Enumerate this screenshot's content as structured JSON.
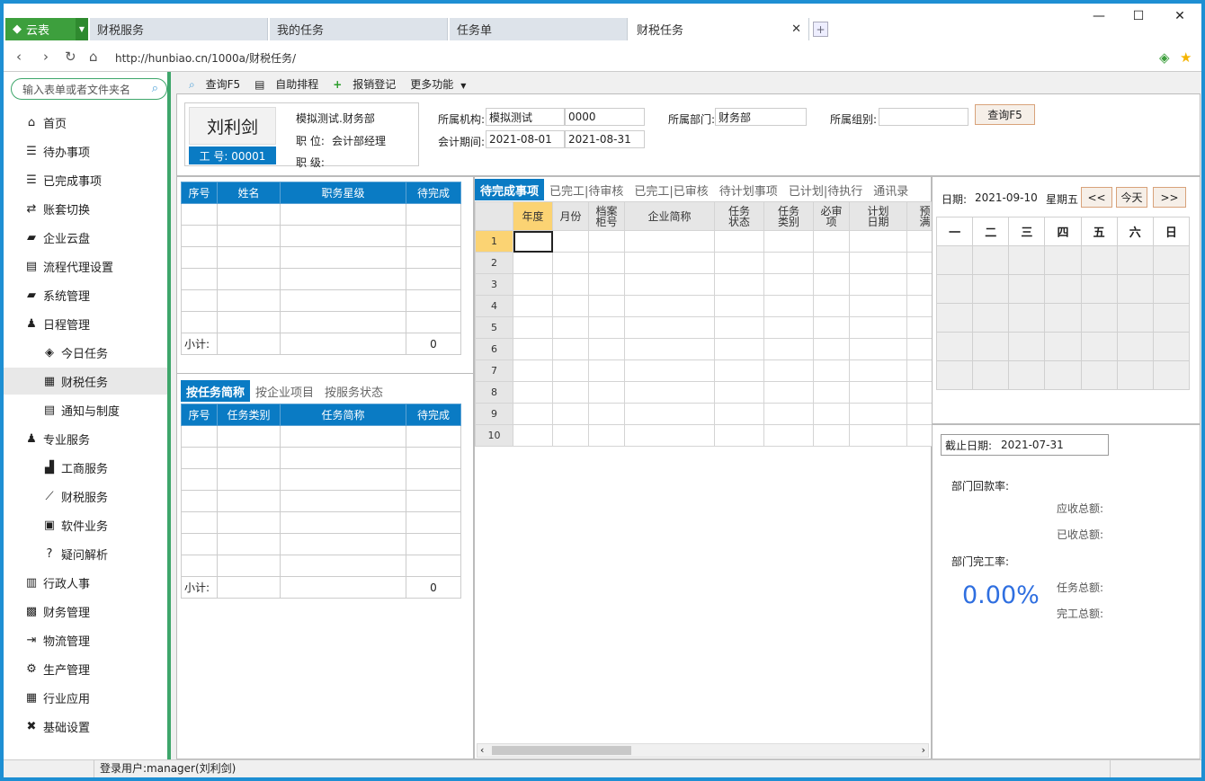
{
  "app": {
    "name": "云表"
  },
  "tabs": [
    "财税服务",
    "我的任务",
    "任务单",
    "财税任务"
  ],
  "window": {
    "min": "—",
    "max": "☐",
    "close": "✕"
  },
  "address": {
    "url": "http://hunbiao.cn/1000a/财税任务/"
  },
  "sidebar": {
    "search_placeholder": "输入表单或者文件夹名",
    "items": [
      "首页",
      "待办事项",
      "已完成事项",
      "账套切换",
      "企业云盘",
      "流程代理设置",
      "系统管理",
      "日程管理",
      "今日任务",
      "财税任务",
      "通知与制度",
      "专业服务",
      "工商服务",
      "财税服务",
      "软件业务",
      "疑问解析",
      "行政人事",
      "财务管理",
      "物流管理",
      "生产管理",
      "行业应用",
      "基础设置"
    ]
  },
  "toolbar": {
    "query": "查询F5",
    "auto_schedule": "自助排程",
    "expense": "报销登记",
    "more": "更多功能"
  },
  "user": {
    "name": "刘利剑",
    "id_label": "工 号: 00001",
    "org_dept": "模拟测试.财务部",
    "position_label": "职 位:",
    "position": "会计部经理",
    "level_label": "职 级:"
  },
  "filters": {
    "org_label": "所属机构:",
    "org_value": "模拟测试",
    "org_code": "0000",
    "dept_label": "所属部门:",
    "dept_value": "财务部",
    "group_label": "所属组别:",
    "group_value": "",
    "period_label": "会计期间:",
    "period_start": "2021-08-01",
    "period_end": "2021-08-31",
    "query_btn": "查询F5"
  },
  "staff_table": {
    "headers": [
      "序号",
      "姓名",
      "职务星级",
      "待完成"
    ],
    "subtotal_label": "小计:",
    "subtotal": "0"
  },
  "task_tabs": [
    "按任务简称",
    "按企业项目",
    "按服务状态"
  ],
  "task_table": {
    "headers": [
      "序号",
      "任务类别",
      "任务简称",
      "待完成"
    ],
    "subtotal_label": "小计:",
    "subtotal": "0"
  },
  "grid_tabs": [
    "待完成事项",
    "已完工|待审核",
    "已完工|已审核",
    "待计划事项",
    "已计划|待执行",
    "通讯录"
  ],
  "grid": {
    "headers": [
      "年度",
      "月份",
      "档案\n柜号",
      "企业简称",
      "任务\n状态",
      "任务\n类别",
      "必审\n项",
      "计划\n日期",
      "预\n满"
    ],
    "rows": [
      "1",
      "2",
      "3",
      "4",
      "5",
      "6",
      "7",
      "8",
      "9",
      "10"
    ]
  },
  "calendar": {
    "date_label": "日期:",
    "date": "2021-09-10",
    "weekday": "星期五",
    "prev": "<<",
    "today": "今天",
    "next": ">>",
    "days": [
      "一",
      "二",
      "三",
      "四",
      "五",
      "六",
      "日"
    ]
  },
  "stats": {
    "cutoff_label": "截止日期:",
    "cutoff": "2021-07-31",
    "collect_rate": "部门回款率:",
    "receivable": "应收总额:",
    "received": "已收总额:",
    "complete_rate": "部门完工率:",
    "percent": "0.00%",
    "task_total": "任务总额:",
    "done_total": "完工总额:"
  },
  "status": {
    "login": "登录用户:manager(刘利剑)"
  }
}
